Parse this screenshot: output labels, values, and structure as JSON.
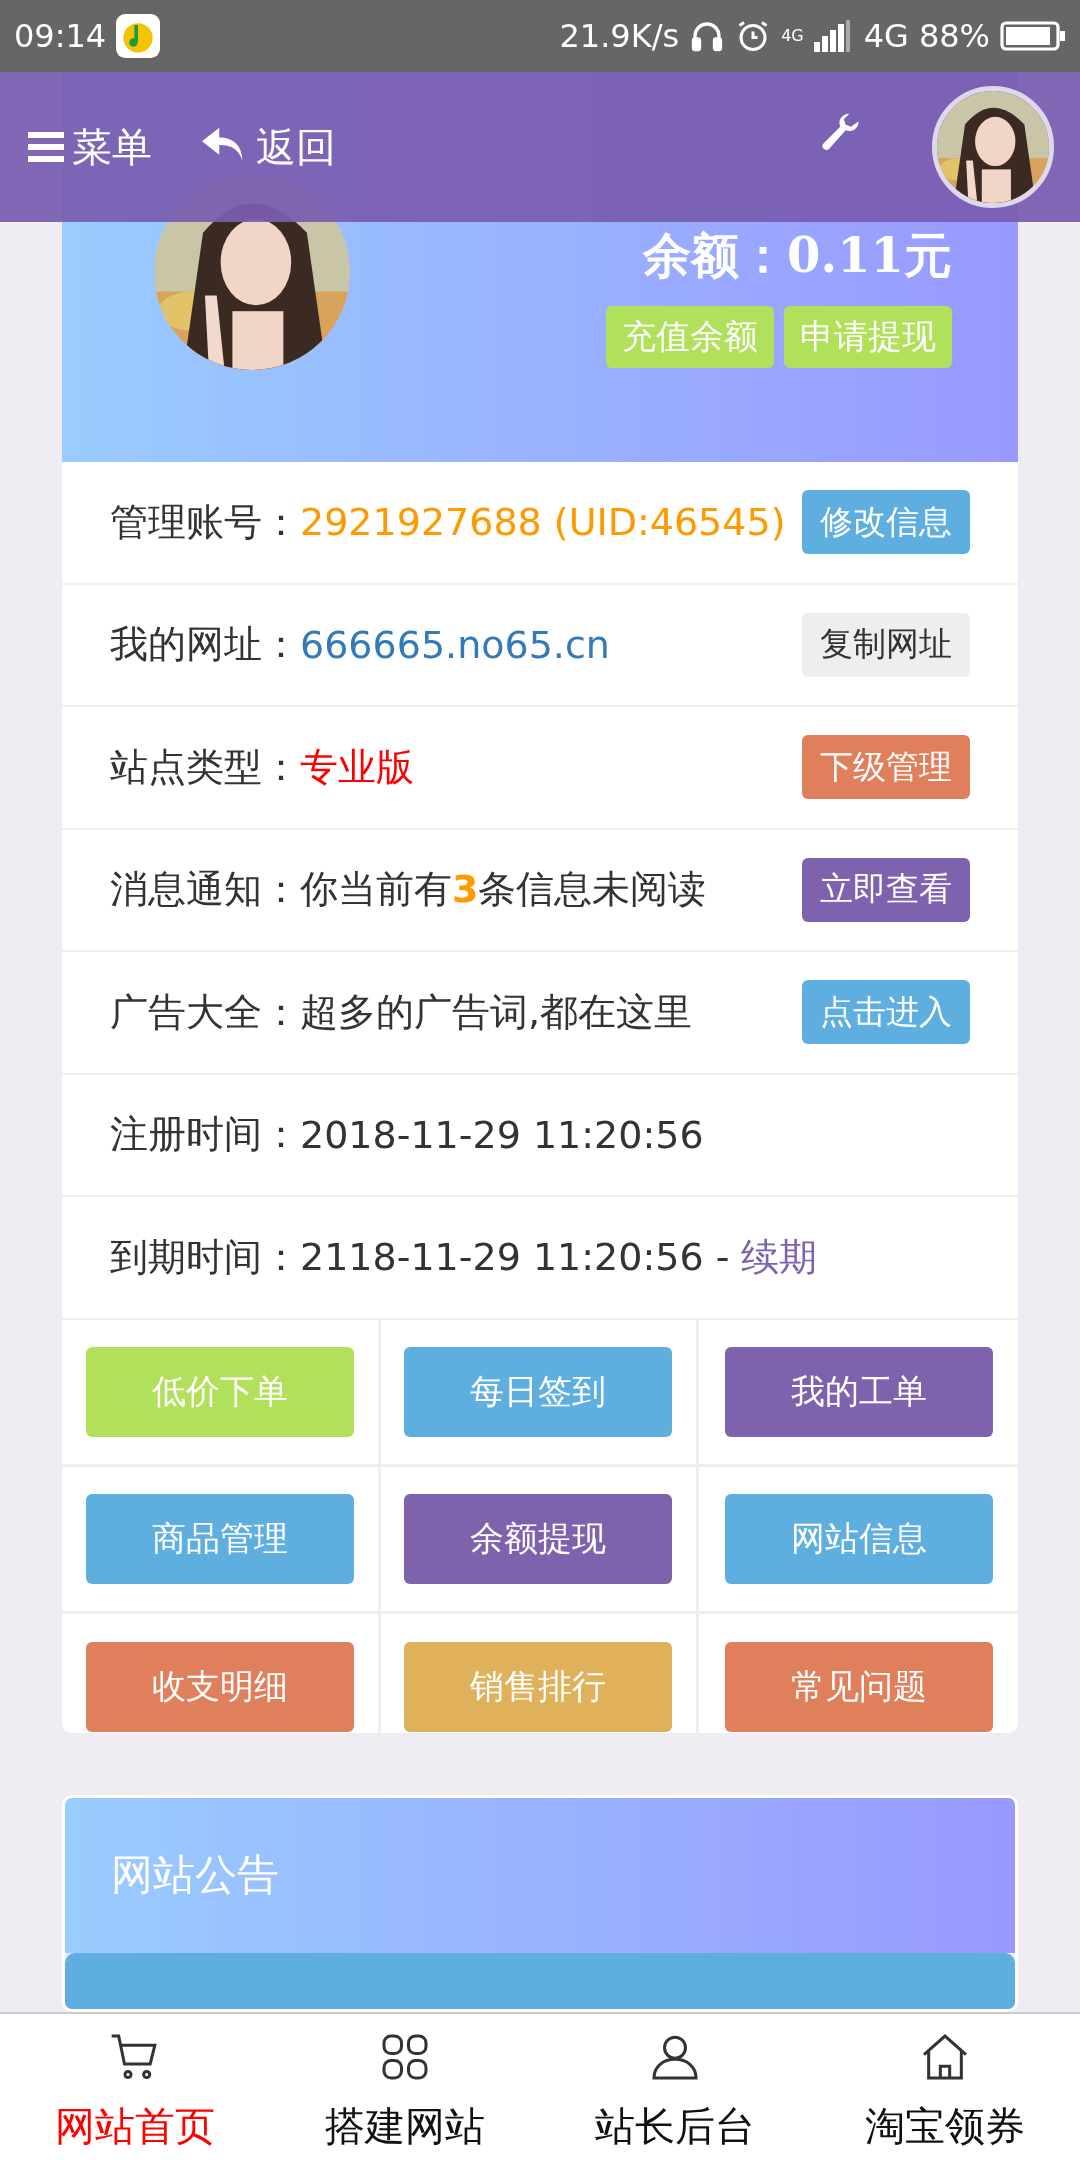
{
  "status_bar": {
    "time": "09:14",
    "speed": "21.9K/s",
    "network_small": "4G",
    "network": "4G",
    "battery": "88%"
  },
  "header": {
    "menu_label": "菜单",
    "back_label": "返回"
  },
  "hero": {
    "balance": "余额：0.11元",
    "buttons": [
      {
        "label": "充值余额"
      },
      {
        "label": "申请提现"
      }
    ]
  },
  "info_rows": [
    {
      "label": "管理账号：",
      "value": "2921927688 (UID:46545)",
      "kind": "account",
      "button": {
        "label": "修改信息",
        "color": "#5eafdf"
      }
    },
    {
      "label": "我的网址：",
      "value": "666665.no65.cn",
      "kind": "url",
      "button": {
        "label": "复制网址",
        "color": "#eeeeee"
      }
    },
    {
      "label": "站点类型：",
      "value": "专业版",
      "kind": "type",
      "button": {
        "label": "下级管理",
        "color": "#e07f5b"
      }
    },
    {
      "label": "消息通知：",
      "value": "你当前有**3**条信息未阅读",
      "kind": "plain",
      "button": {
        "label": "立即查看",
        "color": "#7e62ad"
      }
    },
    {
      "label": "广告大全：",
      "value": "超多的广告词,都在这里",
      "kind": "plain",
      "button": {
        "label": "点击进入",
        "color": "#5eafdf"
      }
    },
    {
      "label": "注册时间：",
      "value": "2018-11-29 11:20:56",
      "kind": "plain"
    },
    {
      "label": "到期时间：",
      "value": "2118-11-29 11:20:56 - ",
      "kind": "plain",
      "link": "续期"
    }
  ],
  "actions": [
    {
      "label": "低价下单",
      "color": "#b1e05b"
    },
    {
      "label": "每日签到",
      "color": "#5eafdf"
    },
    {
      "label": "我的工单",
      "color": "#7e62ad"
    },
    {
      "label": "商品管理",
      "color": "#5eafdf"
    },
    {
      "label": "余额提现",
      "color": "#7e62ad"
    },
    {
      "label": "网站信息",
      "color": "#5eafdf"
    },
    {
      "label": "收支明细",
      "color": "#e07f5b"
    },
    {
      "label": "销售排行",
      "color": "#dfb15b"
    },
    {
      "label": "常见问题",
      "color": "#e07f5b"
    }
  ],
  "notice": {
    "title": "网站公告"
  },
  "bottom_nav": [
    {
      "label": "网站首页",
      "kind": "cart",
      "selected": true
    },
    {
      "label": "搭建网站",
      "kind": "grid",
      "selected": false
    },
    {
      "label": "站长后台",
      "kind": "user",
      "selected": false
    },
    {
      "label": "淘宝领券",
      "kind": "home",
      "selected": false
    }
  ]
}
